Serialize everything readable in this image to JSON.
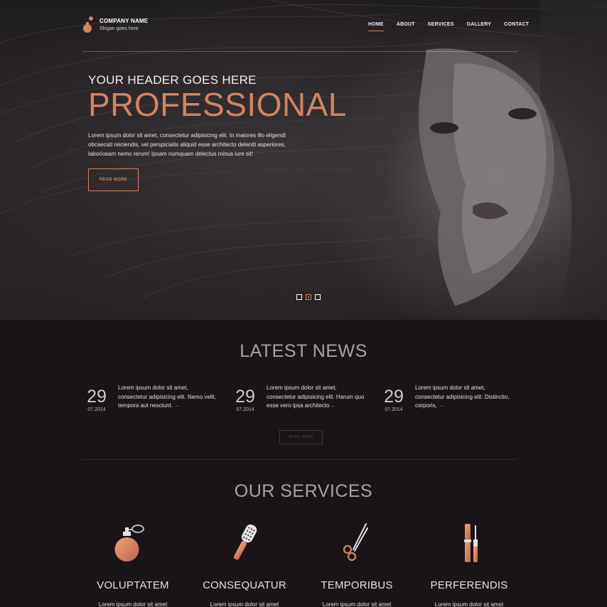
{
  "brand": {
    "name": "COMPANY NAME",
    "slogan": "Slogan goes here"
  },
  "nav": {
    "items": [
      "HOME",
      "ABOUT",
      "SERVICES",
      "GALLERY",
      "CONTACT"
    ],
    "active": "HOME"
  },
  "hero": {
    "subtitle": "YOUR HEADER GOES HERE",
    "title": "PROFESSIONAL",
    "text": "Lorem ipsum dolor sit amet, consectetur adipisicing elit. In maiores illo eligendi obcaecati reiciendis, vel perspiciatis aliquid esse architecto deleniti asperiores, laboriosam nemo rerum! Ipsam numquam delectus minus iure sit!",
    "button": "READ MORE",
    "slides": 3,
    "active_slide": 2
  },
  "news": {
    "title": "LATEST NEWS",
    "items": [
      {
        "day": "29",
        "date": "07.2014",
        "text": "Lorem ipsum dolor sit amet, consectetur adipisicing elit. Nemo velit, tempora aut nesciunt.",
        "arrow": "→"
      },
      {
        "day": "29",
        "date": "07.2014",
        "text": "Lorem ipsum dolor sit amet, consectetur adipisicing elit. Harum quo esse vero ipsa architecto",
        "arrow": "→"
      },
      {
        "day": "29",
        "date": "07.2014",
        "text": "Lorem ipsum dolor sit amet, consectetur adipisicing elit. Distinctio, corporis,",
        "arrow": "→"
      }
    ],
    "more_button": "MORE NEWS"
  },
  "services": {
    "title": "OUR SERVICES",
    "items": [
      {
        "name": "VOLUPTATEM",
        "icon": "perfume-bottle-icon",
        "text": "Lorem ipsum dolor sit amet"
      },
      {
        "name": "CONSEQUATUR",
        "icon": "hair-brush-icon",
        "text": "Lorem ipsum dolor sit amet"
      },
      {
        "name": "TEMPORIBUS",
        "icon": "scissors-icon",
        "text": "Lorem ipsum dolor sit amet"
      },
      {
        "name": "PERFERENDIS",
        "icon": "mascara-icon",
        "text": "Lorem ipsum dolor sit amet"
      }
    ]
  },
  "colors": {
    "accent": "#d4835f",
    "background": "#181418",
    "hero_dark": "#262225"
  }
}
